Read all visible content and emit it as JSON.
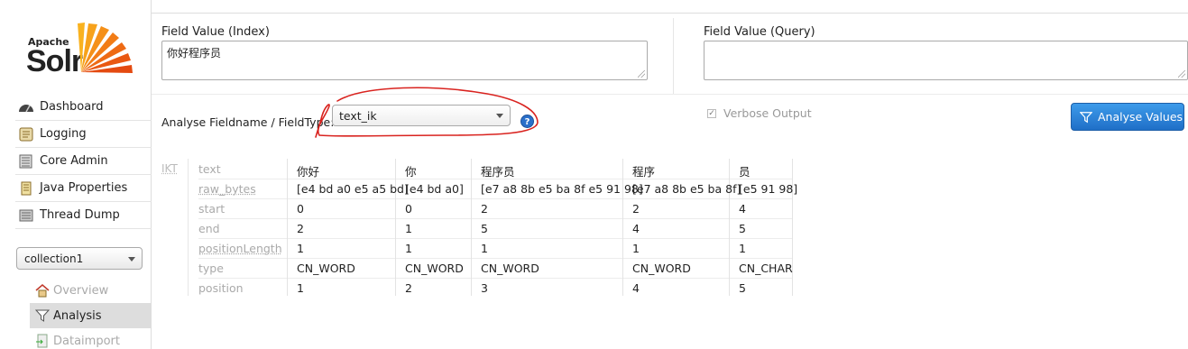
{
  "logo": {
    "top_text": "Apache",
    "main_text": "Solr"
  },
  "sidebar": {
    "items": [
      {
        "label": "Dashboard",
        "icon": "dashboard-icon"
      },
      {
        "label": "Logging",
        "icon": "logging-icon"
      },
      {
        "label": "Core Admin",
        "icon": "core-admin-icon"
      },
      {
        "label": "Java Properties",
        "icon": "java-properties-icon"
      },
      {
        "label": "Thread Dump",
        "icon": "thread-dump-icon"
      }
    ],
    "core_selector": {
      "value": "collection1"
    },
    "core_items": [
      {
        "label": "Overview",
        "icon": "home-icon",
        "active": false
      },
      {
        "label": "Analysis",
        "icon": "filter-icon",
        "active": true
      },
      {
        "label": "Dataimport",
        "icon": "dataimport-icon",
        "active": false
      }
    ]
  },
  "analysis": {
    "index_label": "Field Value (Index)",
    "index_value": "你好程序员",
    "query_label": "Field Value (Query)",
    "query_value": "",
    "fieldtype_label": "Analyse Fieldname / FieldType:",
    "fieldtype_value": "text_ik",
    "help_icon_text": "?",
    "verbose_label": "Verbose Output",
    "verbose_checked": true,
    "analyse_button": "Analyse Values",
    "stage": "IKT",
    "row_names": [
      "text",
      "raw_bytes",
      "start",
      "end",
      "positionLength",
      "type",
      "position"
    ],
    "tokens": [
      {
        "text": "你好",
        "raw_bytes": "[e4 bd a0 e5 a5 bd]",
        "start": "0",
        "end": "2",
        "positionLength": "1",
        "type": "CN_WORD",
        "position": "1"
      },
      {
        "text": "你",
        "raw_bytes": "[e4 bd a0]",
        "start": "0",
        "end": "1",
        "positionLength": "1",
        "type": "CN_WORD",
        "position": "2"
      },
      {
        "text": "程序员",
        "raw_bytes": "[e7 a8 8b e5 ba 8f e5 91 98]",
        "start": "2",
        "end": "5",
        "positionLength": "1",
        "type": "CN_WORD",
        "position": "3"
      },
      {
        "text": "程序",
        "raw_bytes": "[e7 a8 8b e5 ba 8f]",
        "start": "2",
        "end": "4",
        "positionLength": "1",
        "type": "CN_WORD",
        "position": "4"
      },
      {
        "text": "员",
        "raw_bytes": "[e5 91 98]",
        "start": "4",
        "end": "5",
        "positionLength": "1",
        "type": "CN_CHAR",
        "position": "5"
      }
    ]
  },
  "colors": {
    "accent": "#1f6fc7",
    "annotation": "#d9231f",
    "active_bg": "#dddddd"
  }
}
